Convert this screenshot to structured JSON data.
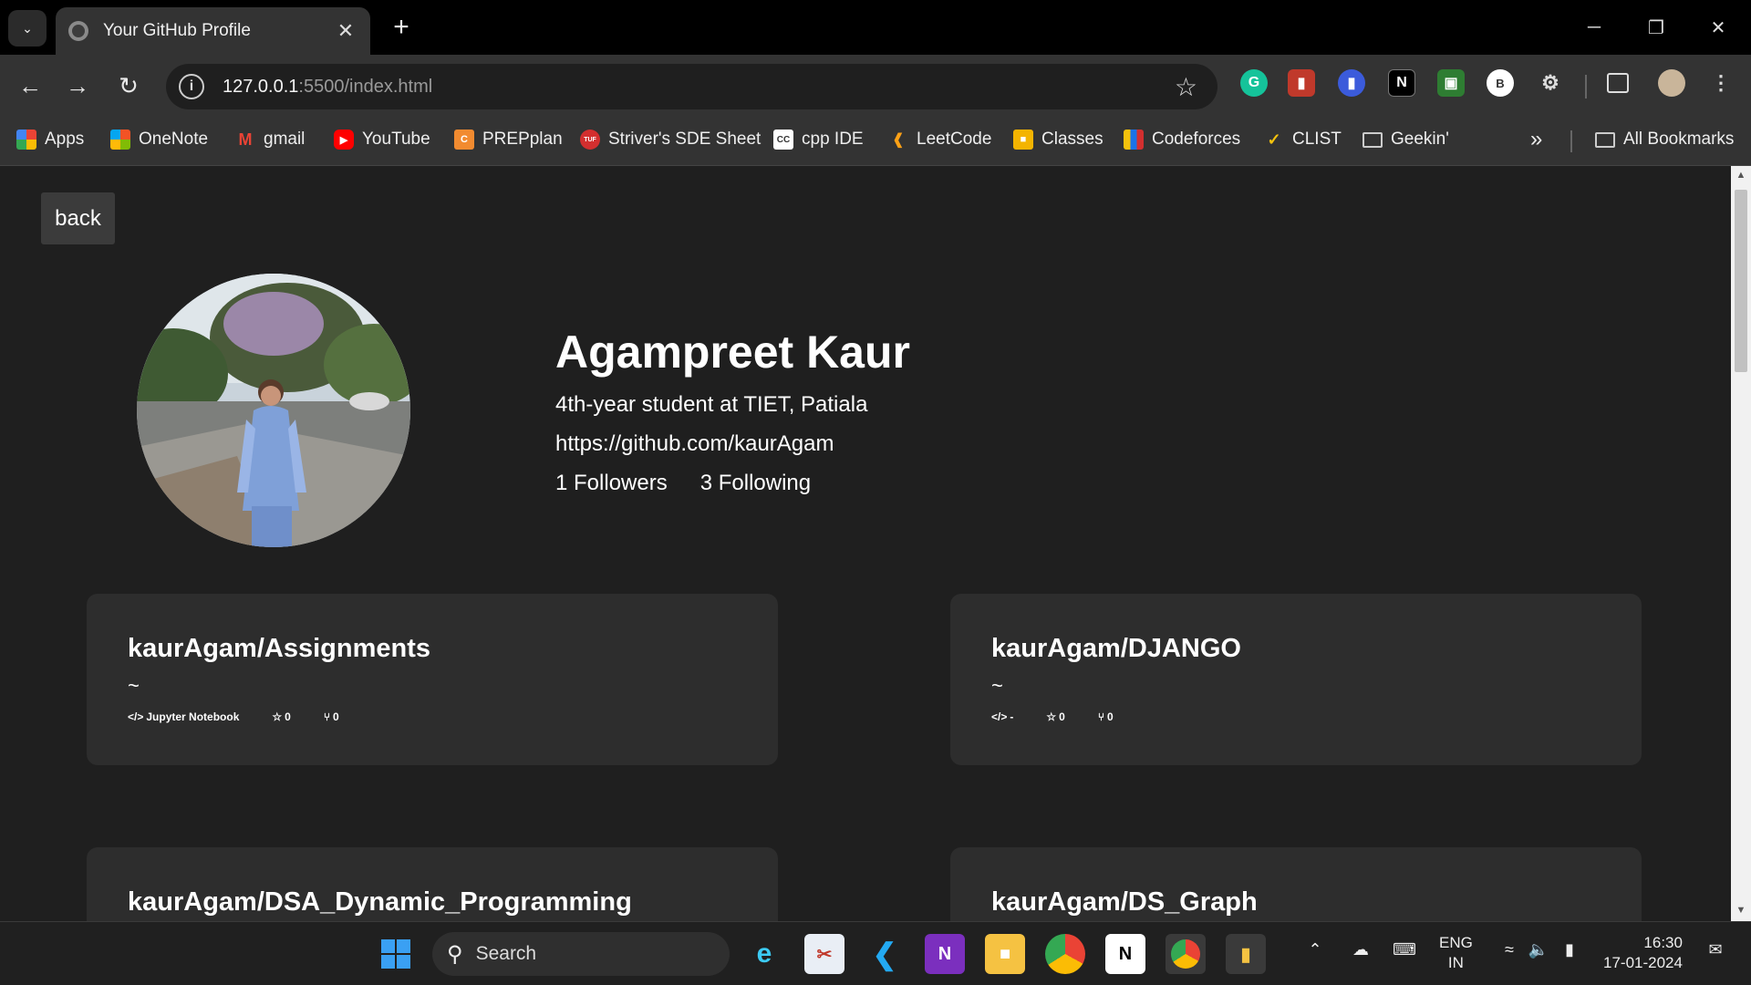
{
  "browser": {
    "tab": {
      "title": "Your GitHub Profile",
      "close": "✕"
    },
    "new_tab": "+",
    "window_controls": {
      "minimize": "─",
      "restore": "❐",
      "close": "✕"
    },
    "url": {
      "host": "127.0.0.1",
      "path": ":5500/index.html"
    },
    "profile_initial": "B",
    "extensions": [
      "grammarly-icon",
      "bookmark-red-icon",
      "shield-blue-icon",
      "notion-ext-icon",
      "lock-green-icon"
    ],
    "bookmarks": [
      {
        "label": "Apps",
        "icon": "apps-grid-icon"
      },
      {
        "label": "OneNote",
        "icon": "microsoft-icon"
      },
      {
        "label": "gmail",
        "icon": "gmail-icon"
      },
      {
        "label": "YouTube",
        "icon": "youtube-icon"
      },
      {
        "label": "PREPplan",
        "icon": "prepplan-icon"
      },
      {
        "label": "Striver's SDE Sheet",
        "icon": "tuf-icon"
      },
      {
        "label": "cpp IDE",
        "icon": "cc-icon"
      },
      {
        "label": "LeetCode",
        "icon": "leetcode-icon"
      },
      {
        "label": "Classes",
        "icon": "classroom-icon"
      },
      {
        "label": "Codeforces",
        "icon": "codeforces-icon"
      },
      {
        "label": "CLIST",
        "icon": "clist-icon"
      },
      {
        "label": "Geekin'",
        "icon": "folder-icon"
      }
    ],
    "overflow": "»",
    "all_bookmarks": "All Bookmarks"
  },
  "page": {
    "back_label": "back",
    "profile": {
      "name": "Agampreet Kaur",
      "bio": "4th-year student at TIET, Patiala",
      "url": "https://github.com/kaurAgam",
      "followers": "1 Followers",
      "following": "3 Following"
    },
    "repos": [
      {
        "name": "kaurAgam/Assignments",
        "desc": "~",
        "language": "Jupyter Notebook",
        "stars": "0",
        "forks": "0"
      },
      {
        "name": "kaurAgam/DJANGO",
        "desc": "~",
        "language": "-",
        "stars": "0",
        "forks": "0"
      },
      {
        "name": "kaurAgam/DSA_Dynamic_Programming",
        "desc": "",
        "language": "",
        "stars": "",
        "forks": ""
      },
      {
        "name": "kaurAgam/DS_Graph",
        "desc": "",
        "language": "",
        "stars": "",
        "forks": ""
      }
    ]
  },
  "taskbar": {
    "search_label": "Search",
    "lang_top": "ENG",
    "lang_bottom": "IN",
    "time": "16:30",
    "date": "17-01-2024"
  },
  "colors": {
    "page_bg": "#1f1f1f",
    "card_bg": "#2d2d2d",
    "chrome_bg": "#333333"
  }
}
